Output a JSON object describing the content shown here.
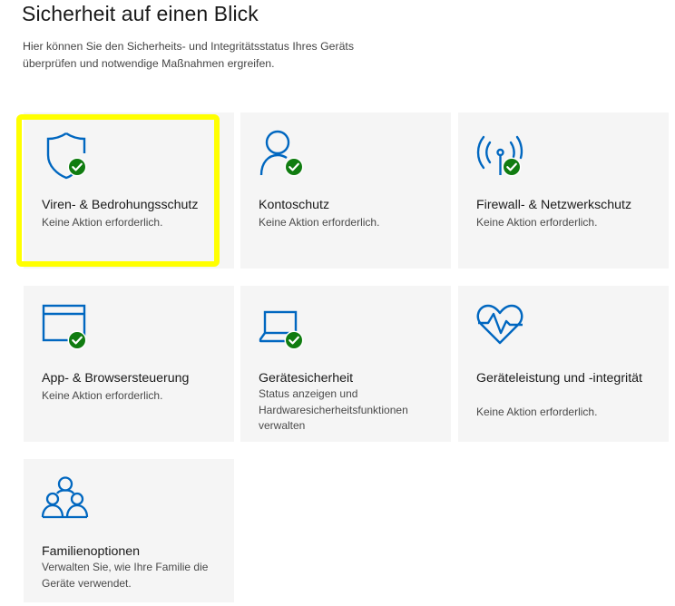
{
  "header": {
    "title": "Sicherheit auf einen Blick",
    "subtitle": "Hier können Sie den Sicherheits- und Integritätsstatus Ihres Geräts überprüfen und notwendige Maßnahmen ergreifen."
  },
  "colors": {
    "accent": "#0067c0",
    "ok": "#107c10",
    "highlight": "#ffff00"
  },
  "tiles": [
    {
      "icon": "shield-check-icon",
      "title": "Viren- & Bedrohungsschutz",
      "status": "Keine Aktion erforderlich."
    },
    {
      "icon": "person-check-icon",
      "title": "Kontoschutz",
      "status": "Keine Aktion erforderlich."
    },
    {
      "icon": "wifi-tower-check-icon",
      "title": "Firewall- & Netzwerkschutz",
      "status": "Keine Aktion erforderlich."
    },
    {
      "icon": "app-window-check-icon",
      "title": "App- & Browsersteuerung",
      "status": "Keine Aktion erforderlich."
    },
    {
      "icon": "laptop-check-icon",
      "title": "Gerätesicherheit",
      "status": "Status anzeigen und Hardwaresicherheitsfunktionen verwalten"
    },
    {
      "icon": "heart-pulse-icon",
      "title": "Geräteleistung und -integrität",
      "status": "Keine Aktion erforderlich."
    },
    {
      "icon": "family-icon",
      "title": "Familienoptionen",
      "status": "Verwalten Sie, wie Ihre Familie die Geräte verwendet."
    }
  ]
}
